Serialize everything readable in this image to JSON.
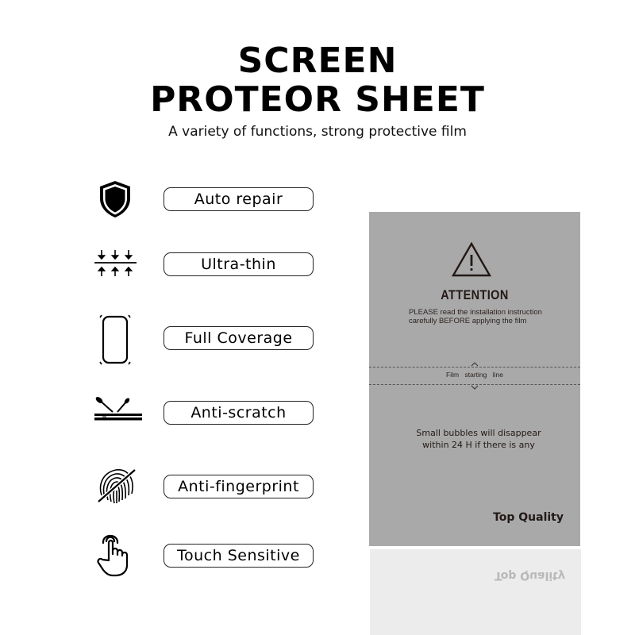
{
  "header": {
    "title_line1": "SCREEN",
    "title_line2": "PROTEOR SHEET",
    "subtitle": "A variety of functions, strong protective film"
  },
  "features": [
    {
      "icon": "shield-icon",
      "label": "Auto repair"
    },
    {
      "icon": "compress-arrows-icon",
      "label": "Ultra-thin"
    },
    {
      "icon": "phone-outline-icon",
      "label": "Full Coverage"
    },
    {
      "icon": "scratch-tools-icon",
      "label": "Anti-scratch"
    },
    {
      "icon": "fingerprint-crossed-icon",
      "label": "Anti-fingerprint"
    },
    {
      "icon": "touch-hand-icon",
      "label": "Touch Sensitive"
    }
  ],
  "sheet": {
    "warning_icon": "warning-triangle-icon",
    "attention_title": "ATTENTION",
    "attention_line1": "PLEASE read the installation instruction",
    "attention_line2": "carefully BEFORE applying the film",
    "film_line_label": "Film starting line",
    "bubbles_line1": "Small bubbles will disappear",
    "bubbles_line2": "within 24 H if there is any",
    "quality_label": "Top Quality",
    "sheet_color": "#a9a9a9",
    "reflection_color": "#ececec"
  }
}
